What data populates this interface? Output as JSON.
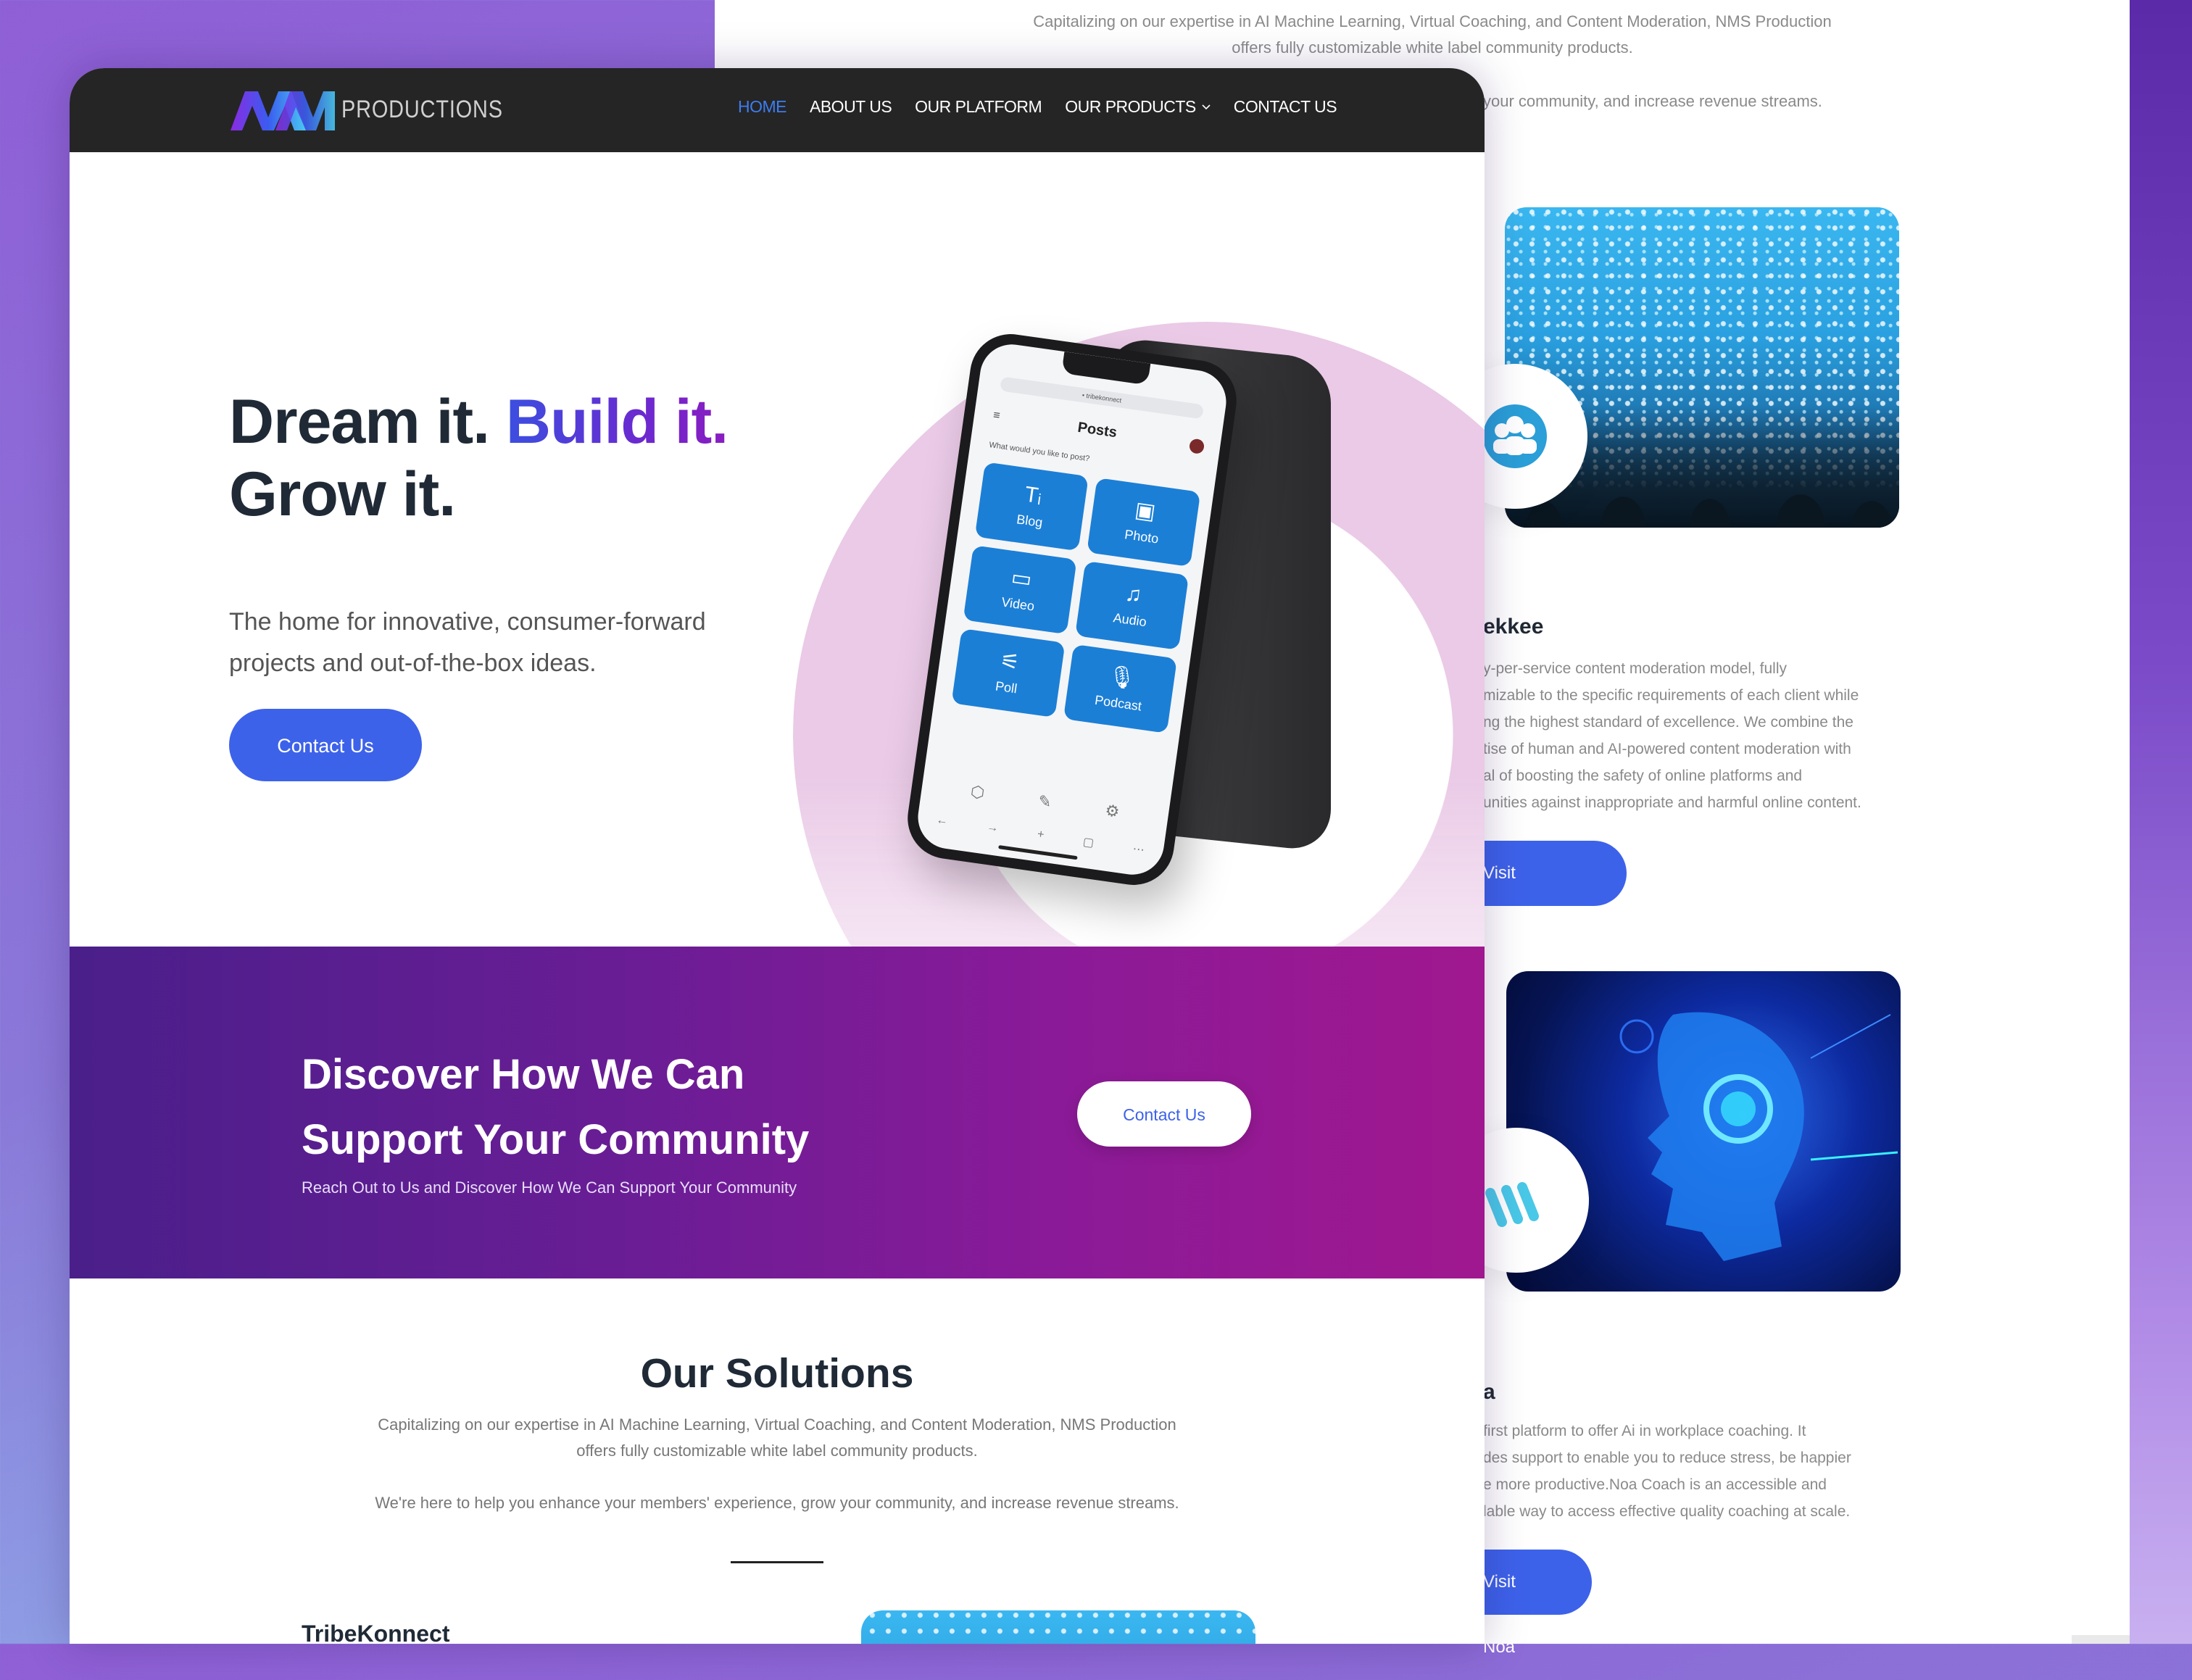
{
  "nav": {
    "logo_text": "PRODUCTIONS",
    "items": [
      {
        "label": "HOME",
        "active": true
      },
      {
        "label": "ABOUT US"
      },
      {
        "label": "OUR PLATFORM"
      },
      {
        "label": "OUR PRODUCTS",
        "has_dropdown": true
      },
      {
        "label": "CONTACT US"
      }
    ]
  },
  "hero": {
    "title_part1": "Dream it. ",
    "title_part2": "Build it.",
    "title_part3": "Grow it.",
    "subtitle": "The home for innovative, consumer-forward projects and out-of-the-box ideas.",
    "cta": "Contact Us"
  },
  "phone": {
    "url": "• tribekonnect",
    "screen_title": "Posts",
    "prompt": "What would you like to post?",
    "tiles": [
      {
        "label": "Blog",
        "icon": "text-icon"
      },
      {
        "label": "Photo",
        "icon": "image-icon"
      },
      {
        "label": "Video",
        "icon": "video-icon"
      },
      {
        "label": "Audio",
        "icon": "music-icon"
      },
      {
        "label": "Poll",
        "icon": "sliders-icon"
      },
      {
        "label": "Podcast",
        "icon": "microphone-icon"
      }
    ]
  },
  "banner": {
    "title": "Discover How We Can Support Your Community",
    "subtitle": "Reach Out to Us and Discover How We Can Support Your Community",
    "cta": "Contact Us"
  },
  "solutions": {
    "title": "Our Solutions",
    "text1": "Capitalizing on our expertise in AI Machine Learning, Virtual Coaching, and Content Moderation, NMS Production offers fully customizable white label community products.",
    "text2": "We're here to help you enhance your members' experience, grow your community, and increase revenue streams.",
    "first_item": "TribeKonnect"
  },
  "background_page": {
    "top_text1": "Capitalizing on our expertise in AI Machine Learning, Virtual Coaching, and Content Moderation, NMS Production",
    "top_text2": "offers fully customizable white label community products.",
    "top_text3": "your community, and increase revenue streams.",
    "chekkee_heading": "ekkee",
    "chekkee_lines": [
      "y-per-service content moderation model, fully",
      "mizable to the specific requirements of each client while",
      "ng the highest standard of excellence. We combine the",
      "tise of human and AI-powered content moderation with",
      "al of boosting the safety of online platforms and",
      "unities against inappropriate and harmful online content."
    ],
    "chekkee_cta": "Visit Chekkee",
    "noa_heading": "a",
    "noa_lines": [
      "first platform to offer Ai in workplace coaching. It",
      "des support to enable you to reduce stress, be happier",
      "e more productive.Noa Coach is an accessible and",
      "lable way to access effective quality coaching at scale."
    ],
    "noa_cta": "Visit Noa"
  },
  "colors": {
    "accent": "#3d62ea",
    "nav_bg": "#252525",
    "banner_start": "#4a1f8a",
    "banner_end": "#a0188f"
  }
}
